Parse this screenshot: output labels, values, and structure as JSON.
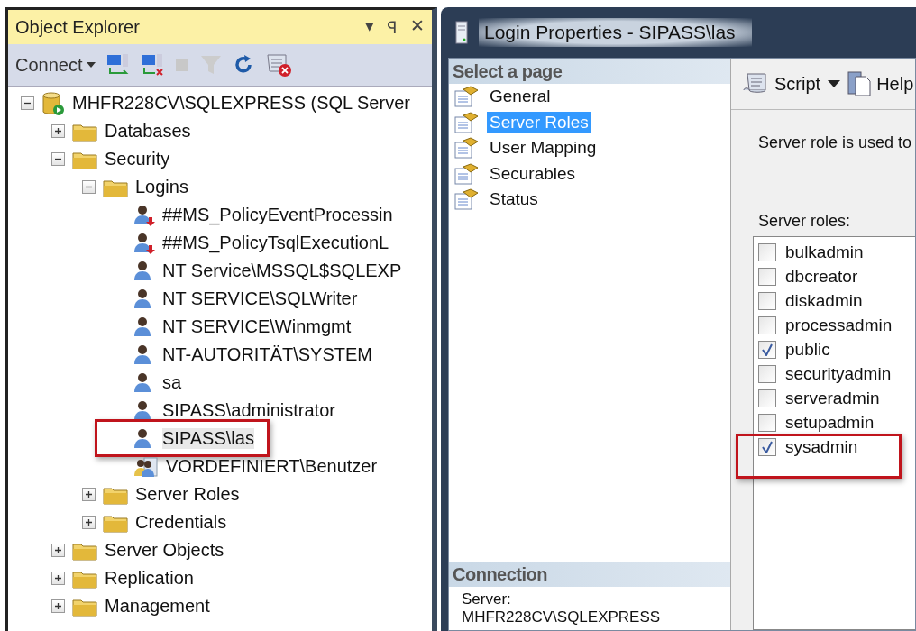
{
  "object_explorer": {
    "title": "Object Explorer",
    "title_buttons": [
      "▾",
      "ꟼ",
      "✕"
    ],
    "toolbar": {
      "connect": "Connect"
    },
    "tree": [
      {
        "label": "MHFR228CV\\SQLEXPRESS (SQL Server",
        "kind": "server",
        "expanded": true,
        "selected": false,
        "children": [
          {
            "label": "Databases",
            "kind": "folder",
            "expanded": false,
            "selected": false
          },
          {
            "label": "Security",
            "kind": "folder",
            "expanded": true,
            "selected": false,
            "children": [
              {
                "label": "Logins",
                "kind": "folder",
                "expanded": true,
                "selected": false,
                "children": [
                  {
                    "label": "##MS_PolicyEventProcessin",
                    "kind": "login_disabled",
                    "selected": false,
                    "annotated": false
                  },
                  {
                    "label": "##MS_PolicyTsqlExecutionL",
                    "kind": "login_disabled",
                    "selected": false,
                    "annotated": false
                  },
                  {
                    "label": "NT Service\\MSSQL$SQLEXP",
                    "kind": "login",
                    "selected": false,
                    "annotated": false
                  },
                  {
                    "label": "NT SERVICE\\SQLWriter",
                    "kind": "login",
                    "selected": false,
                    "annotated": false
                  },
                  {
                    "label": "NT SERVICE\\Winmgmt",
                    "kind": "login",
                    "selected": false,
                    "annotated": false
                  },
                  {
                    "label": "NT-AUTORITÄT\\SYSTEM",
                    "kind": "login",
                    "selected": false,
                    "annotated": false
                  },
                  {
                    "label": "sa",
                    "kind": "login",
                    "selected": false,
                    "annotated": false
                  },
                  {
                    "label": "SIPASS\\administrator",
                    "kind": "login",
                    "selected": false,
                    "annotated": false
                  },
                  {
                    "label": "SIPASS\\las",
                    "kind": "login",
                    "selected": true,
                    "annotated": true
                  },
                  {
                    "label": "VORDEFINIERT\\Benutzer",
                    "kind": "group",
                    "selected": false,
                    "annotated": false
                  }
                ]
              },
              {
                "label": "Server Roles",
                "kind": "folder",
                "expanded": false,
                "selected": false
              },
              {
                "label": "Credentials",
                "kind": "folder",
                "expanded": false,
                "selected": false
              }
            ]
          },
          {
            "label": "Server Objects",
            "kind": "folder",
            "expanded": false,
            "selected": false
          },
          {
            "label": "Replication",
            "kind": "folder",
            "expanded": false,
            "selected": false
          },
          {
            "label": "Management",
            "kind": "folder",
            "expanded": false,
            "selected": false
          }
        ]
      }
    ]
  },
  "dialog": {
    "title": "Login Properties - SIPASS\\las",
    "select_page": {
      "header": "Select a page",
      "pages": [
        {
          "label": "General",
          "selected": false
        },
        {
          "label": "Server Roles",
          "selected": true
        },
        {
          "label": "User Mapping",
          "selected": false
        },
        {
          "label": "Securables",
          "selected": false
        },
        {
          "label": "Status",
          "selected": false
        }
      ]
    },
    "connection": {
      "header": "Connection",
      "server_label": "Server:",
      "server_value": "MHFR228CV\\SQLEXPRESS"
    },
    "toolbar": {
      "script": "Script",
      "help": "Help"
    },
    "description": "Server role is used to",
    "server_roles_label": "Server roles:",
    "server_roles": [
      {
        "label": "bulkadmin",
        "checked": false,
        "annotated": false
      },
      {
        "label": "dbcreator",
        "checked": false,
        "annotated": false
      },
      {
        "label": "diskadmin",
        "checked": false,
        "annotated": false
      },
      {
        "label": "processadmin",
        "checked": false,
        "annotated": false
      },
      {
        "label": "public",
        "checked": true,
        "annotated": false
      },
      {
        "label": "securityadmin",
        "checked": false,
        "annotated": false
      },
      {
        "label": "serveradmin",
        "checked": false,
        "annotated": false
      },
      {
        "label": "setupadmin",
        "checked": false,
        "annotated": false
      },
      {
        "label": "sysadmin",
        "checked": true,
        "annotated": true
      }
    ]
  }
}
